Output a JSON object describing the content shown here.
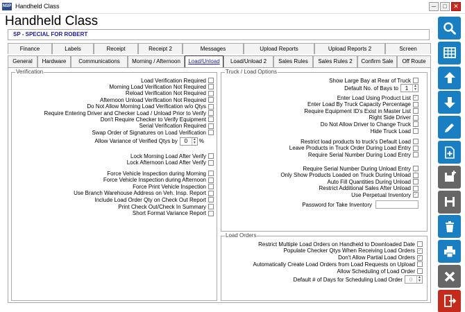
{
  "window": {
    "title": "Handheld Class",
    "minimize": "─",
    "maximize": "□",
    "close": "✕"
  },
  "app_title": "Handheld Class",
  "customer": "SP - SPECIAL FOR ROBERT",
  "tabs_row1": [
    "Finance",
    "Labels",
    "Receipt",
    "Receipt 2",
    "Messages",
    "Upload Reports",
    "Upload Reports 2",
    "Screen"
  ],
  "tabs_row2": [
    "General",
    "Hardware",
    "Communications",
    "Morning / Afternoon",
    "Load/Unload",
    "Load/Unload 2",
    "Sales Rules",
    "Sales Rules 2",
    "Confirm Sale",
    "Off Route"
  ],
  "active_tab": "Load/Unload",
  "verification": {
    "title": "Verification",
    "items": [
      "Load Verification Required",
      "Morning Load Verification Not Required",
      "Reload Verification Not Required",
      "Afternoon Unload Verification Not Required",
      "Do Not Allow Morning Load Verification w/o Qtys",
      "Require Entering Driver and Checker Load / Unload Prior to Verify",
      "Don't Require Checker to Verify Equipment",
      "Serial Verification Required",
      "Swap Order of Signatures on Load Verification"
    ],
    "variance_label": "Allow Variance of Verified Qtys by",
    "variance_value": "0",
    "variance_unit": "%",
    "items2": [
      "Lock Morning Load After Verify",
      "Lock Afternoon Load After Verify"
    ],
    "items3": [
      "Force Vehicle Inspection during Morning",
      "Force Vehicle Inspection during Afternoon",
      "Force Print Vehicle Inspection",
      "Use Branch Warehouse Address on Veh. Insp. Report",
      "Include Load Order Qty on Check Out Report",
      "Print Check Out/Check In Summary",
      "Short Format Variance Report"
    ]
  },
  "truck": {
    "title": "Truck / Load Options",
    "large_bay": "Show Large Bay at Rear of Truck",
    "bays_label": "Default No. of Bays to",
    "bays_value": "1",
    "items": [
      {
        "label": "Enter Load Using Product List",
        "checked": true
      },
      {
        "label": "Enter Load By Truck Capacity Percentage",
        "checked": false
      },
      {
        "label": "Require Equipment ID's Exist in Master List",
        "checked": false
      },
      {
        "label": "Right Side Driver",
        "checked": false
      },
      {
        "label": "Do Not Allow Driver to Change Truck",
        "checked": false
      },
      {
        "label": "Hide Truck Load",
        "checked": false
      }
    ],
    "items2": [
      "Restrict load products to truck's Default Load",
      "Leave Products in Truck Order During Load Entry",
      "Require Serial Number During Load Entry"
    ],
    "items3": [
      {
        "label": "Require Serial Number During Unload Entry",
        "checked": false
      },
      {
        "label": "Only Show Products Loaded on Truck During Unload",
        "checked": false
      },
      {
        "label": "Auto Fill Quantities During Unload",
        "checked": false
      },
      {
        "label": "Restrict Additional Sales After Unload",
        "checked": false
      },
      {
        "label": "Use Perpetual Inventory",
        "checked": true
      }
    ],
    "password_label": "Password for Take Inventory"
  },
  "load_orders": {
    "title": "Load Orders",
    "items": [
      {
        "label": "Restrict Multiple Load Orders on Handheld to Downloaded Date",
        "checked": false
      },
      {
        "label": "Populate Checker Qtys When Receiving Load Orders",
        "checked": true
      },
      {
        "label": "Don't Allow Partial Load Orders",
        "checked": true
      },
      {
        "label": "Automatically Create Load Orders from Load Requests on Upload",
        "checked": false
      },
      {
        "label": "Allow Scheduling of Load Order",
        "checked": false
      }
    ],
    "days_label": "Default # of Days for Scheduling Load Order",
    "days_value": "0"
  },
  "sidebar": [
    "search-icon",
    "grid-icon",
    "arrow-up-icon",
    "arrow-down-icon",
    "edit-icon",
    "new-document-icon",
    "save-new-icon",
    "save-icon",
    "delete-icon",
    "print-icon",
    "cancel-icon",
    "exit-icon"
  ]
}
